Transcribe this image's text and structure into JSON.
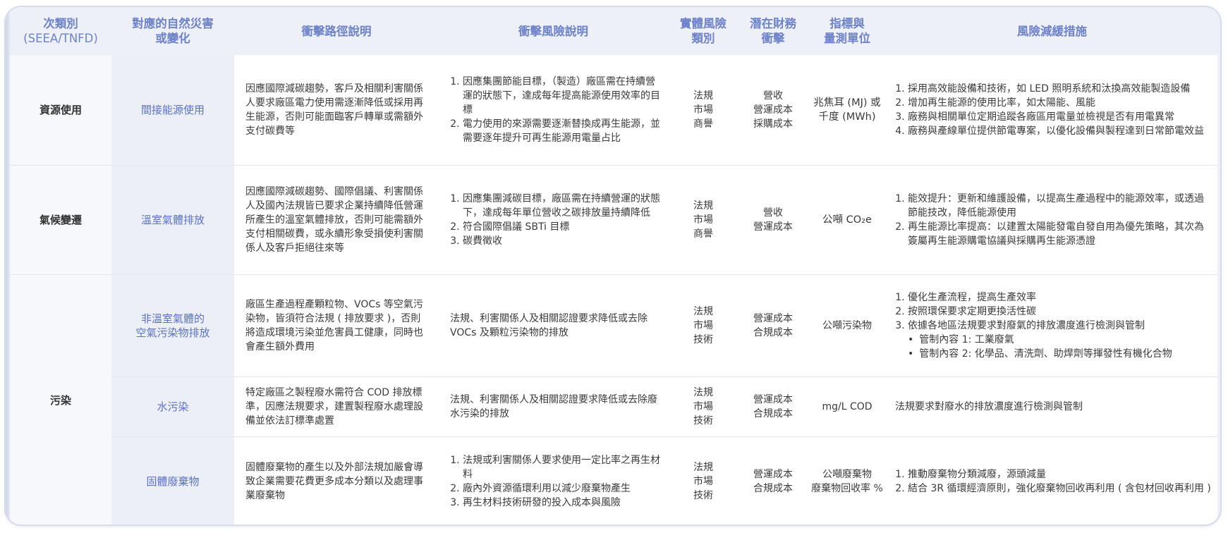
{
  "header": {
    "col1": "次類別",
    "col1_sub": "(SEEA/TNFD)",
    "col2_l1": "對應的自然災害",
    "col2_l2": "或變化",
    "col3": "衝擊路徑說明",
    "col4": "衝擊風險說明",
    "col5_l1": "實體風險",
    "col5_l2": "類別",
    "col6_l1": "潛在財務",
    "col6_l2": "衝擊",
    "col7_l1": "指標與",
    "col7_l2": "量測單位",
    "col8": "風險減緩措施"
  },
  "categories": [
    "資源使用",
    "氣候變遷",
    "污染"
  ],
  "rows": [
    {
      "hazard": [
        "間接能源使用"
      ],
      "path": "因應國際減碳趨勢，客戶及相關利害關係人要求廠區電力使用需逐漸降低或採用再生能源，否則可能面臨客戶轉單或需額外支付碳費等",
      "risk": [
        "因應集團節能目標，（製造）廠區需在持續營運的狀態下，達成每年提高能源使用效率的目標",
        "電力使用的來源需要逐漸替換成再生能源，並需要逐年提升可再生能源用電量占比"
      ],
      "risk_type": [
        "法規",
        "市場",
        "商譽"
      ],
      "financial": [
        "營收",
        "營運成本",
        "採購成本"
      ],
      "metric": [
        "兆焦耳 (MJ) 或",
        "千度 (MWh)"
      ],
      "mitigation": [
        "採用高效能設備和技術，如 LED 照明系統和汰換高效能製造設備",
        "增加再生能源的使用比率，如太陽能、風能",
        "廠務與相關單位定期追蹤各廠區用電量並檢視是否有用電異常",
        "廠務與產線單位提供節電專案，以優化設備與製程達到日常節電效益"
      ]
    },
    {
      "hazard": [
        "溫室氣體排放"
      ],
      "path": "因應國際減碳趨勢、國際倡議、利害關係人及國內法規皆已要求企業持續降低營運所產生的溫室氣體排放，否則可能需額外支付相關碳費，或永續形象受損使利害關係人及客戶拒絕往來等",
      "risk": [
        "因應集團減碳目標，廠區需在持續營運的狀態下，達成每年單位營收之碳排放量持續降低",
        "符合國際倡議 SBTi 目標",
        "碳費徵收"
      ],
      "risk_type": [
        "法規",
        "市場",
        "商譽"
      ],
      "financial": [
        "營收",
        "營運成本"
      ],
      "metric": [
        "公噸 CO₂e"
      ],
      "mitigation": [
        "能效提升：更新和維護設備，以提高生產過程中的能源效率，或透過節能技改，降低能源使用",
        "再生能源比率提高：以建置太陽能發電自發自用為優先策略，其次為簽屬再生能源購電協議與採購再生能源憑證"
      ]
    },
    {
      "hazard": [
        "非溫室氣體的",
        "空氣污染物排放"
      ],
      "path": "廠區生產過程產顆粒物、VOCs 等空氣污染物，皆須符合法規 ( 排放要求 )，否則將造成環境污染並危害員工健康，同時也會產生額外費用",
      "risk_text": "法規、利害關係人及相關認證要求降低或去除 VOCs 及顆粒污染物的排放",
      "risk_type": [
        "法規",
        "市場",
        "技術"
      ],
      "financial": [
        "營運成本",
        "合規成本"
      ],
      "metric": [
        "公噸污染物"
      ],
      "mitigation": [
        "優化生產流程，提高生產效率",
        "按照環保要求定期更換活性碳",
        "依據各地區法規要求對廢氣的排放濃度進行檢測與管制"
      ],
      "mitigation_bullets": [
        "管制內容 1: 工業廢氣",
        "管制內容 2: 化學品、清洗劑、助焊劑等揮發性有機化合物"
      ]
    },
    {
      "hazard": [
        "水污染"
      ],
      "path": "特定廠區之製程廢水需符合 COD 排放標準，因應法規要求，建置製程廢水處理設備並依法訂標準處置",
      "risk_text": "法規、利害關係人及相關認證要求降低或去除廢水污染的排放",
      "risk_type": [
        "法規",
        "市場",
        "技術"
      ],
      "financial": [
        "營運成本",
        "合規成本"
      ],
      "metric": [
        "mg/L COD"
      ],
      "mitigation_text": "法規要求對廢水的排放濃度進行檢測與管制"
    },
    {
      "hazard": [
        "固體廢棄物"
      ],
      "path": "固體廢棄物的產生以及外部法規加嚴會導致企業需要花費更多成本分類以及處理事業廢棄物",
      "risk": [
        "法規或利害關係人要求使用一定比率之再生材料",
        "廠內外資源循環利用以減少廢棄物產生",
        "再生材料技術研發的投入成本與風險"
      ],
      "risk_type": [
        "法規",
        "市場",
        "技術"
      ],
      "financial": [
        "營運成本",
        "合規成本"
      ],
      "metric": [
        "公噸廢棄物",
        "廢棄物回收率 %"
      ],
      "mitigation": [
        "推動廢棄物分類減廢，源頭減量",
        "結合 3R 循環經濟原則，強化廢棄物回收再利用 ( 含包材回收再利用 )"
      ]
    }
  ]
}
